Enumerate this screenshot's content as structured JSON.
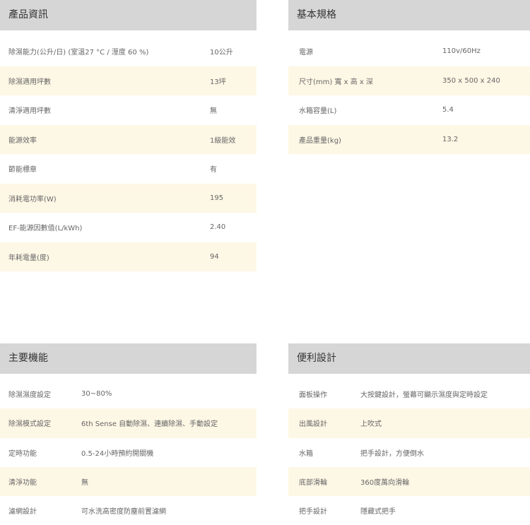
{
  "sections": {
    "product_info": {
      "title": "產品資訊",
      "rows": [
        {
          "label": "除濕能力(公升/日) (室溫27 °C / 溼度 60 %)",
          "value": "10公升"
        },
        {
          "label": "除濕適用坪數",
          "value": "13坪"
        },
        {
          "label": "清淨適用坪數",
          "value": "無"
        },
        {
          "label": "能源效率",
          "value": "1級能效"
        },
        {
          "label": "節能標章",
          "value": "有"
        },
        {
          "label": "消耗電功率(W)",
          "value": "195"
        },
        {
          "label": "EF-能源因數值(L/kWh)",
          "value": "2.40"
        },
        {
          "label": "年耗電量(度)",
          "value": "94"
        }
      ]
    },
    "basic_specs": {
      "title": "基本規格",
      "rows": [
        {
          "label": "電源",
          "value": "110v/60Hz"
        },
        {
          "label": "尺寸(mm) 寬 x 高 x 深",
          "value": "350 x 500 x 240"
        },
        {
          "label": "水箱容量(L)",
          "value": "5.4"
        },
        {
          "label": "產品重量(kg)",
          "value": "13.2"
        }
      ]
    },
    "main_functions": {
      "title": "主要機能",
      "rows": [
        {
          "label": "除濕濕度設定",
          "value": "30~80%"
        },
        {
          "label": "除濕模式設定",
          "value": "6th Sense 自動除濕、連續除濕、手動設定"
        },
        {
          "label": "定時功能",
          "value": "0.5-24小時預約開關機"
        },
        {
          "label": "清淨功能",
          "value": "無"
        },
        {
          "label": "濾網設計",
          "value": "可水洗高密度防塵前置濾網"
        }
      ]
    },
    "convenience_design": {
      "title": "便利設計",
      "rows": [
        {
          "label": "面板操作",
          "value": "大按鍵設計，螢幕可顯示濕度與定時設定"
        },
        {
          "label": "出風設計",
          "value": "上吹式"
        },
        {
          "label": "水箱",
          "value": "把手設計，方便倒水"
        },
        {
          "label": "底部滑輪",
          "value": "360度萬向滑輪"
        },
        {
          "label": "把手設計",
          "value": "隱藏式把手"
        }
      ]
    }
  }
}
